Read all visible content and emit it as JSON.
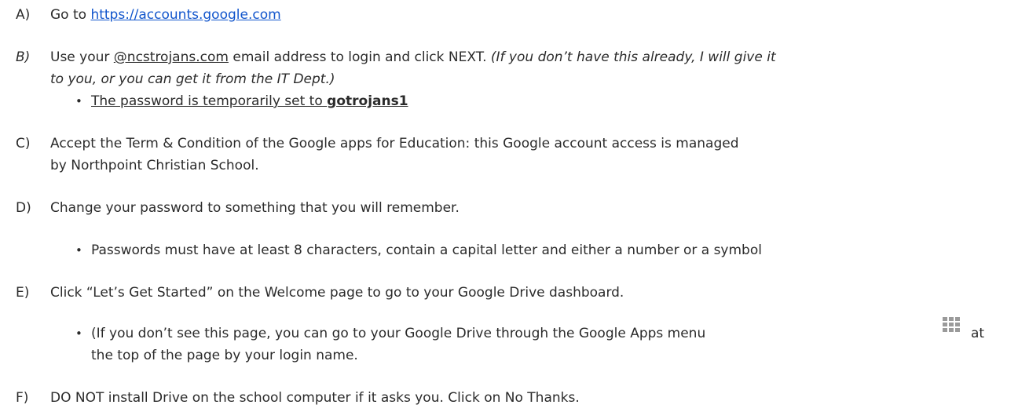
{
  "steps": {
    "a": {
      "marker": "A)",
      "text": "Go to ",
      "link": "https://accounts.google.com"
    },
    "b": {
      "marker": "B)",
      "link": "@ncstrojans.com",
      "text": " email address to login and click NEXT. ",
      "prefix": "Use your ",
      "italic_1": "(If you don’t have this already, I will give it",
      "italic_2": "to you, or you can get it from the IT Dept.)",
      "bullet_text": "The password is temporarily set to ",
      "bullet_bold": "gotrojans1"
    },
    "c": {
      "marker": "C)",
      "line1": "Accept the Term & Condition of the Google apps for Education: this Google account access is managed",
      "line2": "by Northpoint Christian School."
    },
    "d": {
      "marker": "D)",
      "text": "Change your password to something that you will remember.",
      "bullet": "Passwords must have at least 8 characters, contain a capital letter and either a number or a symbol"
    },
    "e": {
      "marker": "E)",
      "text": "Click “Let’s Get Started” on the Welcome page to go to your Google Drive dashboard.",
      "bullet_line1": "(If you don’t see this page, you can go to your Google Drive through the Google Apps menu",
      "bullet_line1_end": "at",
      "bullet_line2": "the top of the page by your login name."
    },
    "f": {
      "marker": "F)",
      "text": "DO NOT install Drive on the school computer if it asks you. Click on No Thanks."
    }
  },
  "bullet_char": "•",
  "icons": {
    "apps": "google-apps-grid-icon"
  },
  "colors": {
    "link": "#1155cc",
    "text": "#2b2b2b",
    "icon": "#9a9a9a"
  }
}
